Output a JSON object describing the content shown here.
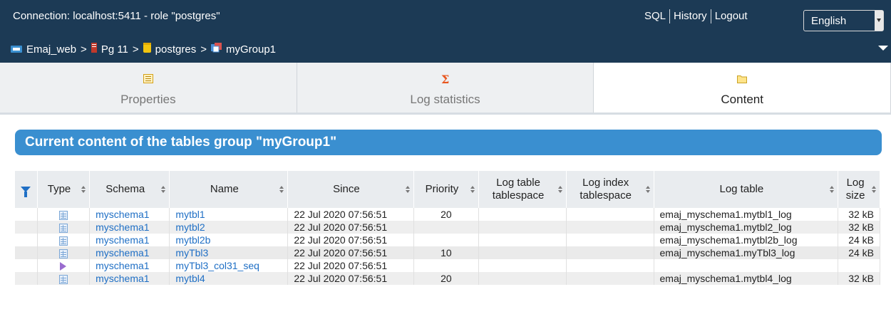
{
  "header": {
    "connection_prefix": "Connection:",
    "host": "localhost:5411",
    "role_text": "- role \"postgres\"",
    "links": {
      "sql": "SQL",
      "history": "History",
      "logout": "Logout"
    },
    "language": "English",
    "breadcrumb": {
      "app": "Emaj_web",
      "server": "Pg 11",
      "database": "postgres",
      "group": "myGroup1",
      "sep": ">"
    }
  },
  "tabs": [
    {
      "label": "Properties",
      "icon": "properties-icon"
    },
    {
      "label": "Log statistics",
      "icon": "sigma-icon"
    },
    {
      "label": "Content",
      "icon": "folder-icon"
    }
  ],
  "section_title": "Current content of the tables group \"myGroup1\"",
  "table": {
    "headers": {
      "type": "Type",
      "schema": "Schema",
      "name": "Name",
      "since": "Since",
      "priority": "Priority",
      "log_table_tablespace_1": "Log table",
      "log_table_tablespace_2": "tablespace",
      "log_index_tablespace_1": "Log index",
      "log_index_tablespace_2": "tablespace",
      "log_table": "Log table",
      "log_size_1": "Log",
      "log_size_2": "size"
    },
    "rows": [
      {
        "type": "table",
        "schema": "myschema1",
        "name": "mytbl1",
        "since": "22 Jul 2020 07:56:51",
        "priority": "20",
        "log_tbl_ts": "",
        "log_idx_ts": "",
        "log_table": "emaj_myschema1.mytbl1_log",
        "log_size": "32 kB"
      },
      {
        "type": "table",
        "schema": "myschema1",
        "name": "mytbl2",
        "since": "22 Jul 2020 07:56:51",
        "priority": "",
        "log_tbl_ts": "",
        "log_idx_ts": "",
        "log_table": "emaj_myschema1.mytbl2_log",
        "log_size": "32 kB"
      },
      {
        "type": "table",
        "schema": "myschema1",
        "name": "mytbl2b",
        "since": "22 Jul 2020 07:56:51",
        "priority": "",
        "log_tbl_ts": "",
        "log_idx_ts": "",
        "log_table": "emaj_myschema1.mytbl2b_log",
        "log_size": "24 kB"
      },
      {
        "type": "table",
        "schema": "myschema1",
        "name": "myTbl3",
        "since": "22 Jul 2020 07:56:51",
        "priority": "10",
        "log_tbl_ts": "",
        "log_idx_ts": "",
        "log_table": "emaj_myschema1.myTbl3_log",
        "log_size": "24 kB"
      },
      {
        "type": "sequence",
        "schema": "myschema1",
        "name": "myTbl3_col31_seq",
        "since": "22 Jul 2020 07:56:51",
        "priority": "",
        "log_tbl_ts": "",
        "log_idx_ts": "",
        "log_table": "",
        "log_size": ""
      },
      {
        "type": "table",
        "schema": "myschema1",
        "name": "mytbl4",
        "since": "22 Jul 2020 07:56:51",
        "priority": "20",
        "log_tbl_ts": "",
        "log_idx_ts": "",
        "log_table": "emaj_myschema1.mytbl4_log",
        "log_size": "32 kB"
      }
    ]
  }
}
